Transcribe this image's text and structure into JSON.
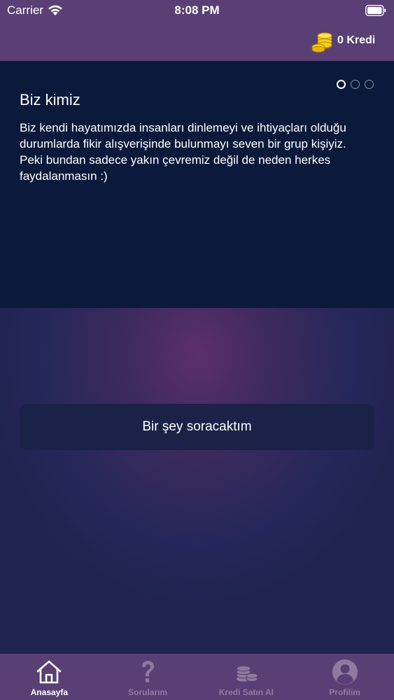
{
  "status_bar": {
    "carrier": "Carrier",
    "time": "8:08 PM"
  },
  "header": {
    "credit_label": "0 Kredi"
  },
  "info_card": {
    "title": "Biz kimiz",
    "body": "Biz kendi hayatımızda insanları dinlemeyi ve ihtiyaçları olduğu durumlarda fikir alışverişinde bulunmayı seven bir grup kişiyiz. Peki bundan sadece yakın çevremiz değil de neden herkes faydalanmasın :)",
    "page_count": 3,
    "current_page": 1
  },
  "main": {
    "ask_button_label": "Bir şey soracaktım"
  },
  "tab_bar": {
    "items": [
      {
        "label": "Anasayfa",
        "icon": "home-icon",
        "active": true
      },
      {
        "label": "Sorularım",
        "icon": "question-icon",
        "active": false
      },
      {
        "label": "Kredi Satın Al",
        "icon": "coins-icon",
        "active": false
      },
      {
        "label": "Profilim",
        "icon": "profile-icon",
        "active": false
      }
    ]
  },
  "colors": {
    "bar": "#5a3f74",
    "card": "#0b1a3a",
    "button": "#1a2247",
    "inactive_tab": "#8e7a9f"
  }
}
